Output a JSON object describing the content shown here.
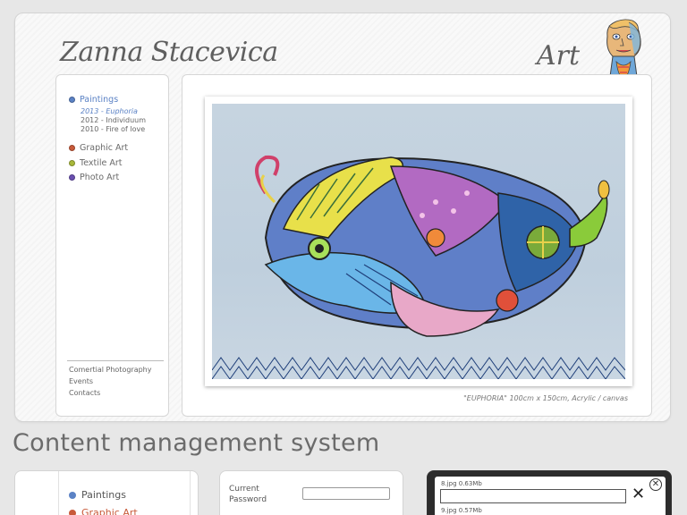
{
  "site": {
    "logo": "Zanna Stacevica",
    "art_label": "Art",
    "nav": {
      "items": [
        {
          "label": "Paintings",
          "color": "#5b82c5",
          "active": true
        },
        {
          "label": "Graphic Art",
          "color": "#c85a3a"
        },
        {
          "label": "Textile Art",
          "color": "#a8b83a"
        },
        {
          "label": "Photo Art",
          "color": "#6a4fb0"
        }
      ],
      "sub_items": [
        {
          "label": "2013 - Euphoria",
          "active": true
        },
        {
          "label": "2012 - Individuum"
        },
        {
          "label": "2010 - Fire of love"
        }
      ],
      "footer": [
        "Comertial Photography",
        "Events",
        "Contacts"
      ]
    },
    "painting": {
      "caption": "\"EUPHORIA\" 100cm x 150cm, Acrylic / canvas"
    }
  },
  "cms": {
    "heading": "Content management system",
    "nav": {
      "items": [
        {
          "label": "Paintings",
          "color": "#5b82c5",
          "text_color": "#555555"
        },
        {
          "label": "Graphic Art",
          "color": "#c85a3a",
          "text_color": "#c85a3a"
        }
      ]
    },
    "password": {
      "label": "Current Password",
      "value": ""
    },
    "upload": {
      "files": [
        {
          "label": "8.jpg 0.63Mb"
        },
        {
          "label": "9.jpg 0.57Mb"
        }
      ],
      "remove_glyph": "✕",
      "close_glyph": "✕"
    }
  },
  "colors": {
    "accent": "#5b82c5",
    "text": "#6a6a6a"
  }
}
